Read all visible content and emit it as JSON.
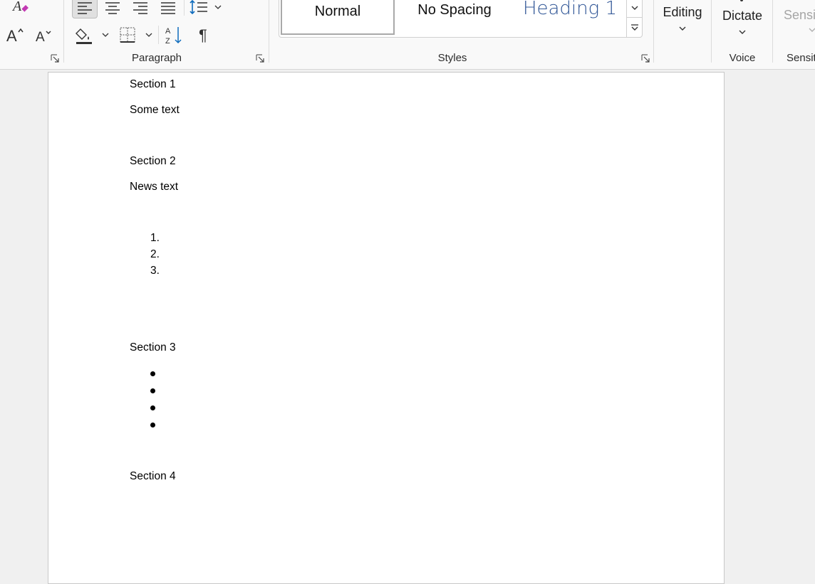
{
  "ribbon": {
    "groups": {
      "paragraph": "Paragraph",
      "styles": "Styles",
      "voice": "Voice",
      "sensitivity": "Sensit"
    },
    "styles_gallery": [
      "Normal",
      "No Spacing",
      "Heading 1"
    ],
    "editing": "Editing",
    "dictate": "Dictate",
    "sensitivity_button": "Sensit"
  },
  "document": {
    "section1": {
      "heading": "Section 1",
      "body": "Some text"
    },
    "section2": {
      "heading": "Section 2",
      "body": "News text",
      "numbered_items": [
        "1.",
        "2.",
        "3."
      ]
    },
    "section3": {
      "heading": "Section 3",
      "bullet_count": 4
    },
    "section4": {
      "heading": "Section 4"
    }
  }
}
